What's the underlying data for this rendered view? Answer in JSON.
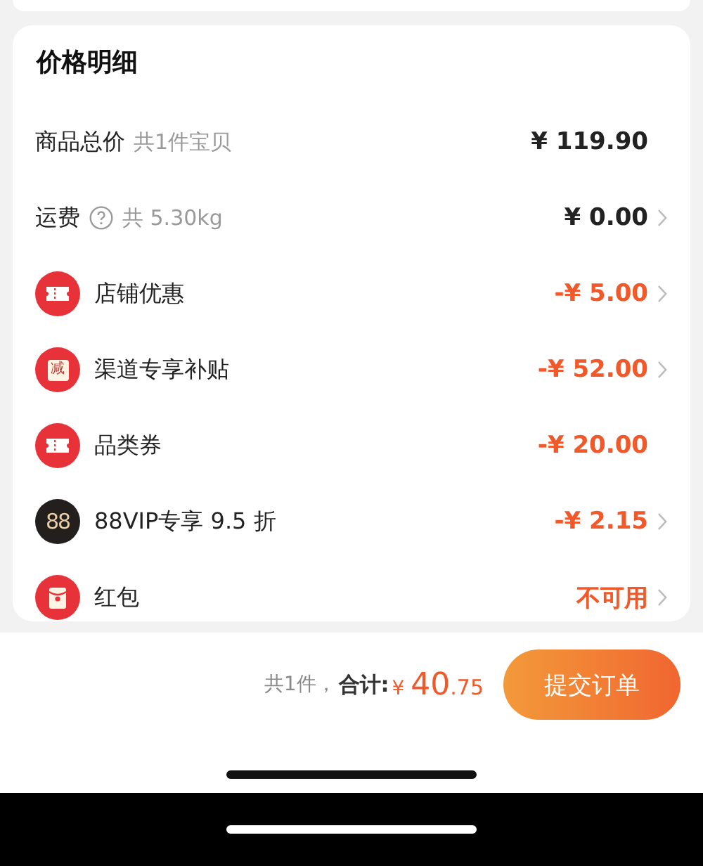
{
  "price_detail": {
    "title": "价格明细",
    "rows": [
      {
        "kind": "plain",
        "label": "商品总价",
        "note": "共1件宝贝",
        "value": "¥ 119.90",
        "chevron": false
      },
      {
        "kind": "plain",
        "label": "运费",
        "help": true,
        "note": "共 5.30kg",
        "value": "¥ 0.00",
        "chevron": true
      },
      {
        "kind": "ticket",
        "label": "店铺优惠",
        "value": "-¥ 5.00",
        "chevron": true
      },
      {
        "kind": "subsidy",
        "icon_label": "减",
        "label": "渠道专享补贴",
        "value": "-¥ 52.00",
        "chevron": true
      },
      {
        "kind": "ticket",
        "label": "品类券",
        "value": "-¥ 20.00",
        "chevron": false
      },
      {
        "kind": "vip",
        "icon_label": "88",
        "label": "88VIP专享 9.5 折",
        "value": "-¥ 2.15",
        "chevron": true
      },
      {
        "kind": "envelope",
        "label": "红包",
        "value": "不可用",
        "chevron": true
      }
    ]
  },
  "footer": {
    "count": "共1件，",
    "total_label": "合计:",
    "currency": "¥",
    "total_main": "40",
    "total_decimals": ".75",
    "submit": "提交订单"
  }
}
